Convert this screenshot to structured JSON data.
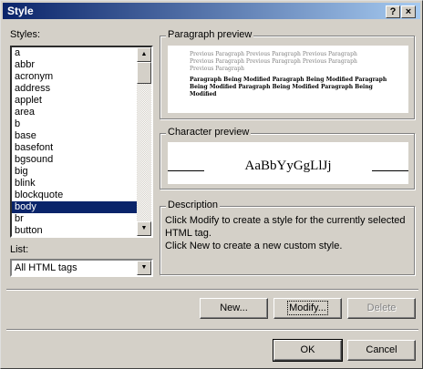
{
  "window": {
    "title": "Style",
    "help_glyph": "?",
    "close_glyph": "×"
  },
  "styles": {
    "label": "Styles:",
    "items": [
      "a",
      "abbr",
      "acronym",
      "address",
      "applet",
      "area",
      "b",
      "base",
      "basefont",
      "bgsound",
      "big",
      "blink",
      "blockquote",
      "body",
      "br",
      "button"
    ],
    "selected": "body"
  },
  "list": {
    "label": "List:",
    "value": "All HTML tags"
  },
  "paragraph_preview": {
    "caption": "Paragraph preview",
    "previous_lines": [
      "Previous Paragraph Previous Paragraph Previous Paragraph",
      "Previous Paragraph Previous Paragraph Previous Paragraph",
      "Previous Paragraph"
    ],
    "modified_lines": [
      "Paragraph Being Modified Paragraph Being Modified Paragraph",
      "Being Modified Paragraph Being Modified Paragraph Being",
      "Modified"
    ]
  },
  "character_preview": {
    "caption": "Character preview",
    "sample": "AaBbYyGgLlJj"
  },
  "description": {
    "caption": "Description",
    "lines": [
      "Click Modify to create a style for the currently selected",
      "HTML tag.",
      "Click New to create a new custom style."
    ]
  },
  "buttons": {
    "new": "New...",
    "modify": "Modify...",
    "delete": "Delete",
    "ok": "OK",
    "cancel": "Cancel"
  }
}
